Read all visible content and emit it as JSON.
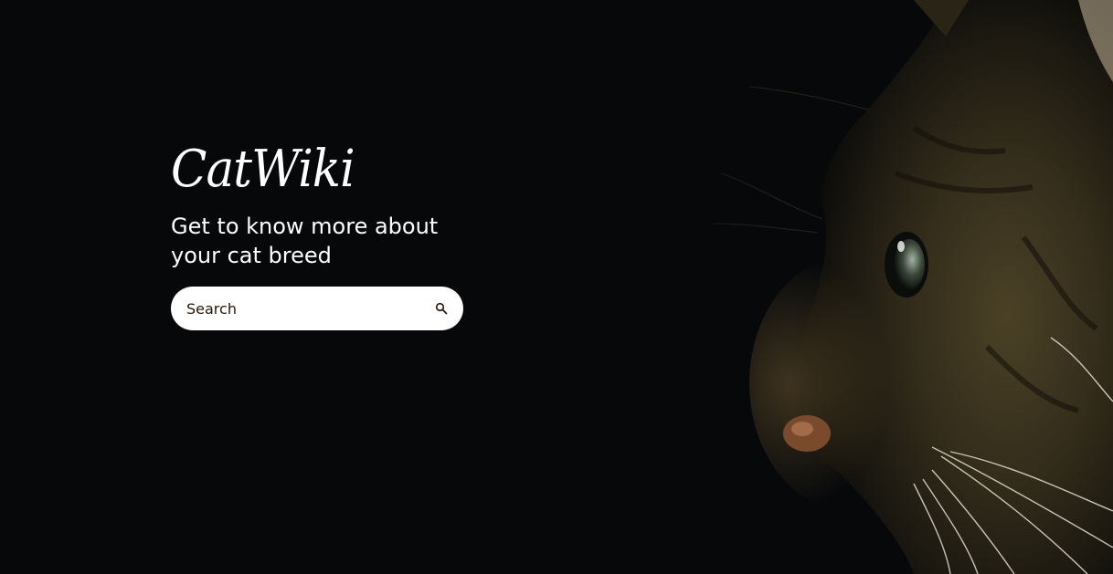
{
  "brand": {
    "logo_text": "CatWiki"
  },
  "hero": {
    "tagline": "Get to know more about your cat breed",
    "background_color": "#06080a"
  },
  "search": {
    "placeholder": "Search",
    "value": "",
    "icon": "search-icon"
  },
  "image": {
    "subject": "tabby cat profile facing left",
    "icon": "cat-photo"
  },
  "colors": {
    "text_primary": "#ffffff",
    "search_text": "#291507",
    "search_bg": "#ffffff"
  }
}
